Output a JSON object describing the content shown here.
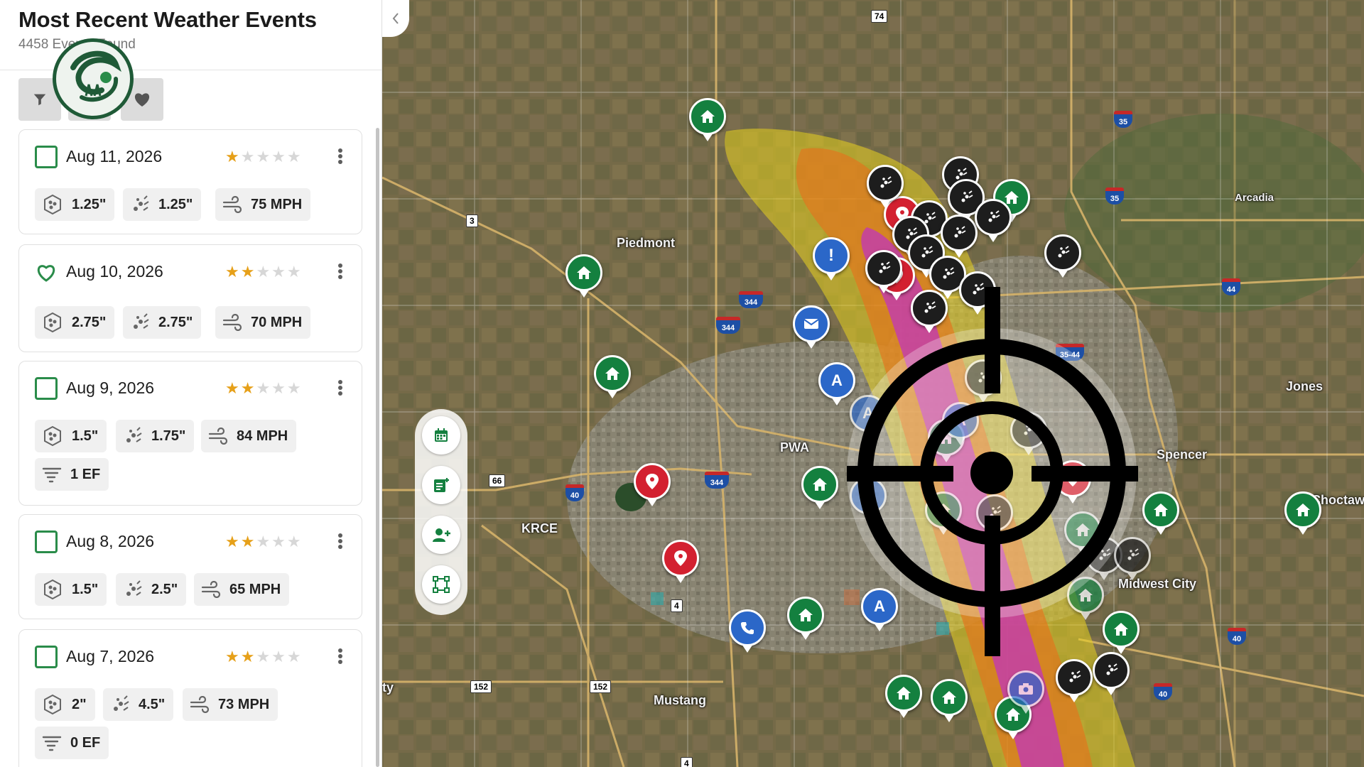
{
  "sidebar": {
    "title": "Most Recent Weather Events",
    "subtitle": "4458 Events Found",
    "tools": {
      "filter_icon": "filter-icon",
      "layers_icon": "bars-icon",
      "favorite_icon": "heart-icon"
    },
    "events": [
      {
        "date": "Aug 11, 2026",
        "select": "checkbox",
        "rating": 1,
        "hail_size": "1.25\"",
        "hail_max": "1.25\"",
        "wind": "75 MPH",
        "tornado": ""
      },
      {
        "date": "Aug 10, 2026",
        "select": "heart",
        "rating": 2,
        "hail_size": "2.75\"",
        "hail_max": "2.75\"",
        "wind": "70 MPH",
        "tornado": ""
      },
      {
        "date": "Aug 9, 2026",
        "select": "checkbox",
        "rating": 2,
        "hail_size": "1.5\"",
        "hail_max": "1.75\"",
        "wind": "84 MPH",
        "tornado": "1 EF"
      },
      {
        "date": "Aug 8, 2026",
        "select": "checkbox",
        "rating": 2,
        "hail_size": "1.5\"",
        "hail_max": "2.5\"",
        "wind": "65 MPH",
        "tornado": ""
      },
      {
        "date": "Aug 7, 2026",
        "select": "checkbox",
        "rating": 2,
        "hail_size": "2\"",
        "hail_max": "4.5\"",
        "wind": "73 MPH",
        "tornado": "0 EF"
      }
    ]
  },
  "map": {
    "places": [
      "Piedmont",
      "Arcadia",
      "Jones",
      "Spencer",
      "Choctaw",
      "PWA",
      "KRCE",
      "Mustang",
      "Midwest City",
      "ty"
    ],
    "highways": [
      "74",
      "35",
      "35",
      "3",
      "344",
      "344",
      "344",
      "35-44",
      "44",
      "66",
      "40",
      "40",
      "4",
      "152",
      "152",
      "4",
      "40"
    ],
    "swath_colors": {
      "outer": "#e8d21f",
      "mid": "#e5731c",
      "inner": "#c032c0"
    },
    "pin_colors": {
      "home": "#14803f",
      "location": "#d32030",
      "contact": "#2b67c8",
      "hail": "#1d1d1d"
    },
    "toolbar": [
      "calendar-icon",
      "add-note-icon",
      "add-person-icon",
      "draw-area-icon"
    ]
  }
}
